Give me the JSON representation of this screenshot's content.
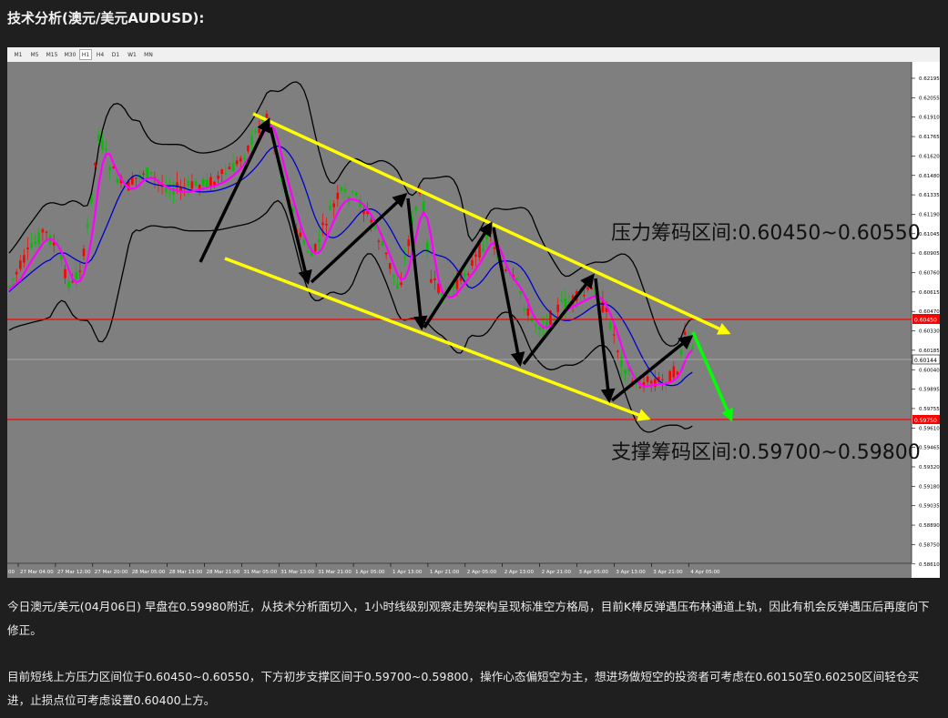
{
  "heading": "技术分析(澳元/美元AUDUSD):",
  "chart": {
    "timeframes": [
      "M1",
      "M5",
      "M15",
      "M30",
      "H1",
      "H4",
      "D1",
      "W1",
      "MN"
    ],
    "active_timeframe": "H1",
    "price_labels": [
      "0.62195",
      "0.62055",
      "0.61910",
      "0.61765",
      "0.61620",
      "0.61480",
      "0.61335",
      "0.61190",
      "0.61045",
      "0.60905",
      "0.60760",
      "0.60615",
      "0.60470",
      "0.60330",
      "0.60185",
      "0.60040",
      "0.59895",
      "0.59755",
      "0.59610",
      "0.59465",
      "0.59320",
      "0.59180",
      "0.59035",
      "0.58890",
      "0.58750",
      "0.58610"
    ],
    "current_price_tag": "0.60144",
    "resist_line_tag": "0.60450",
    "support_line_tag": "0.59750",
    "date_labels": [
      "27 Mar 04:00",
      "27 Mar 12:00",
      "27 Mar 20:00",
      "28 Mar 05:00",
      "28 Mar 13:00",
      "28 Mar 21:00",
      "31 Mar 05:00",
      "31 Mar 13:00",
      "31 Mar 21:00",
      "1 Apr 05:00",
      "1 Apr 13:00",
      "1 Apr 21:00",
      "2 Apr 05:00",
      "2 Apr 13:00",
      "2 Apr 21:00",
      "3 Apr 05:00",
      "3 Apr 13:00",
      "3 Apr 21:00",
      "4 Apr 05:00"
    ],
    "first_date_partial": "00",
    "resistance_text": "压力筹码区间:0.60450~0.60550",
    "support_text": "支撑筹码区间:0.59700~0.59800",
    "colors": {
      "bg": "#7f7f7f",
      "bull": "#ff0000",
      "bear": "#00c000",
      "band": "#000000",
      "mid_blue": "#0000cc",
      "ma_magenta": "#ff00ff",
      "channel": "#ffff00",
      "down_arrow": "#00ff00",
      "hline": "#ff0000"
    }
  },
  "paragraph1": "今日澳元/美元(04月06日) 早盘在0.59980附近，从技术分析面切入，1小时线级别观察走势架构呈现标准空方格局，目前K棒反弹遇压布林通道上轨，因此有机会反弹遇压后再度向下修正。",
  "paragraph2": "目前短线上方压力区间位于0.60450~0.60550，下方初步支撑区间于0.59700~0.59800，操作心态偏短空为主，想进场做短空的投资者可考虑在0.60150至0.60250区间轻仓买进，止损点位可考虑设置0.60400上方。"
}
